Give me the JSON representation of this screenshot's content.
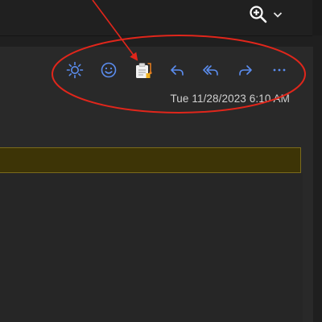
{
  "window": {
    "zoom_icon": "zoom-in-icon",
    "dropdown_icon": "chevron-down-icon"
  },
  "toolbar": {
    "buttons": [
      {
        "name": "brightness-icon"
      },
      {
        "name": "emoji-icon"
      },
      {
        "name": "addin-clipboard-icon"
      },
      {
        "name": "reply-icon"
      },
      {
        "name": "reply-all-icon"
      },
      {
        "name": "forward-icon"
      },
      {
        "name": "more-options-icon"
      }
    ]
  },
  "message": {
    "timestamp": "Tue 11/28/2023 6:10 AM"
  },
  "colors": {
    "accent": "#5b8def",
    "banner_bg": "#3d3406",
    "banner_border": "#7a6a1c",
    "annotation": "#e0261b"
  }
}
